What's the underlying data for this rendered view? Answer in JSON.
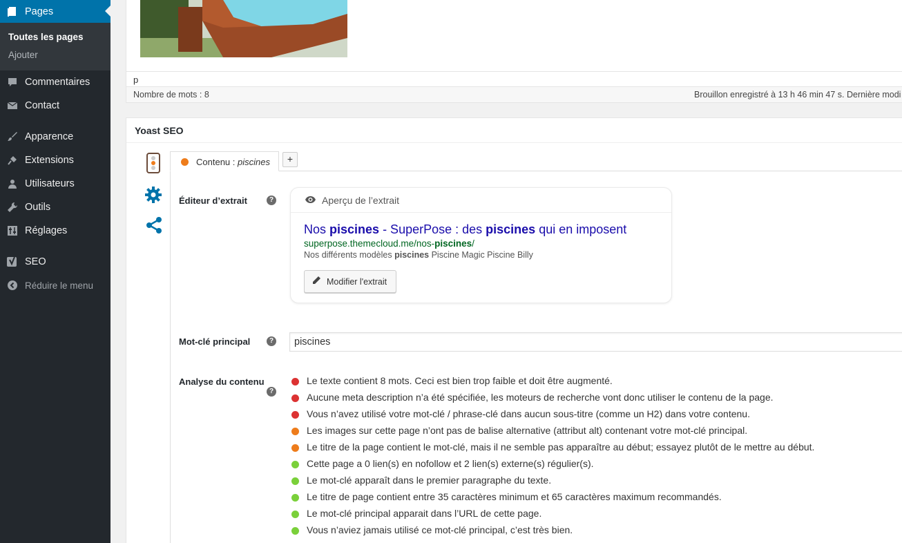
{
  "sidebar": {
    "current": "Pages",
    "submenu": [
      "Toutes les pages",
      "Ajouter"
    ],
    "items": [
      {
        "label": "Commentaires",
        "icon": "comment-icon"
      },
      {
        "label": "Contact",
        "icon": "mail-icon"
      },
      {
        "label": "Apparence",
        "icon": "paintbrush-icon"
      },
      {
        "label": "Extensions",
        "icon": "plugin-icon"
      },
      {
        "label": "Utilisateurs",
        "icon": "user-icon"
      },
      {
        "label": "Outils",
        "icon": "wrench-icon"
      },
      {
        "label": "Réglages",
        "icon": "sliders-icon"
      },
      {
        "label": "SEO",
        "icon": "yoast-icon"
      }
    ],
    "collapse": "Réduire le menu"
  },
  "editor": {
    "path": "p",
    "word_count": "Nombre de mots : 8",
    "draft_status": "Brouillon enregistré à 13 h 46 min 47 s. Dernière modi"
  },
  "yoast": {
    "title": "Yoast SEO",
    "tab": {
      "label": "Contenu :",
      "keyword": "piscines"
    },
    "tab_add": "+",
    "snippet": {
      "label": "Éditeur d’extrait",
      "preview_label": "Aperçu de l’extrait",
      "title_parts": [
        "Nos ",
        "piscines",
        " - SuperPose : des ",
        "piscines",
        " qui en imposent"
      ],
      "url_parts": [
        "superpose.themecloud.me/nos-",
        "piscines",
        "/"
      ],
      "desc_parts": [
        "Nos différents modèles ",
        "piscines",
        " Piscine Magic Piscine Billy"
      ],
      "edit_button": "Modifier l'extrait"
    },
    "keyword": {
      "label": "Mot-clé principal",
      "value": "piscines"
    },
    "analysis": {
      "label": "Analyse du contenu",
      "items": [
        {
          "status": "bad",
          "text": "Le texte contient 8 mots. Ceci est bien trop faible et doit être augmenté."
        },
        {
          "status": "bad",
          "text": "Aucune meta description n’a été spécifiée, les moteurs de recherche vont donc utiliser le contenu de la page."
        },
        {
          "status": "bad",
          "text": "Vous n’avez utilisé votre mot-clé / phrase-clé dans aucun sous-titre (comme un H2) dans votre contenu."
        },
        {
          "status": "ok",
          "text": "Les images sur cette page n’ont pas de balise alternative (attribut alt) contenant votre mot-clé principal."
        },
        {
          "status": "ok",
          "text": "Le titre de la page contient le mot-clé, mais il ne semble pas apparaître au début; essayez plutôt de le mettre au début."
        },
        {
          "status": "good",
          "text": "Cette page a 0 lien(s) en nofollow et 2 lien(s) externe(s) régulier(s)."
        },
        {
          "status": "good",
          "text": "Le mot-clé apparaît dans le premier paragraphe du texte."
        },
        {
          "status": "good",
          "text": "Le titre de page contient entre 35 caractères minimum et 65 caractères maximum recommandés."
        },
        {
          "status": "good",
          "text": "Le mot-clé principal apparait dans l’URL de cette page."
        },
        {
          "status": "good",
          "text": "Vous n’aviez jamais utilisé ce mot-clé principal, c’est très bien."
        }
      ]
    }
  },
  "colors": {
    "bad": "#dc3232",
    "ok": "#ee7c1b",
    "good": "#7ad03a",
    "accent": "#0073aa"
  }
}
